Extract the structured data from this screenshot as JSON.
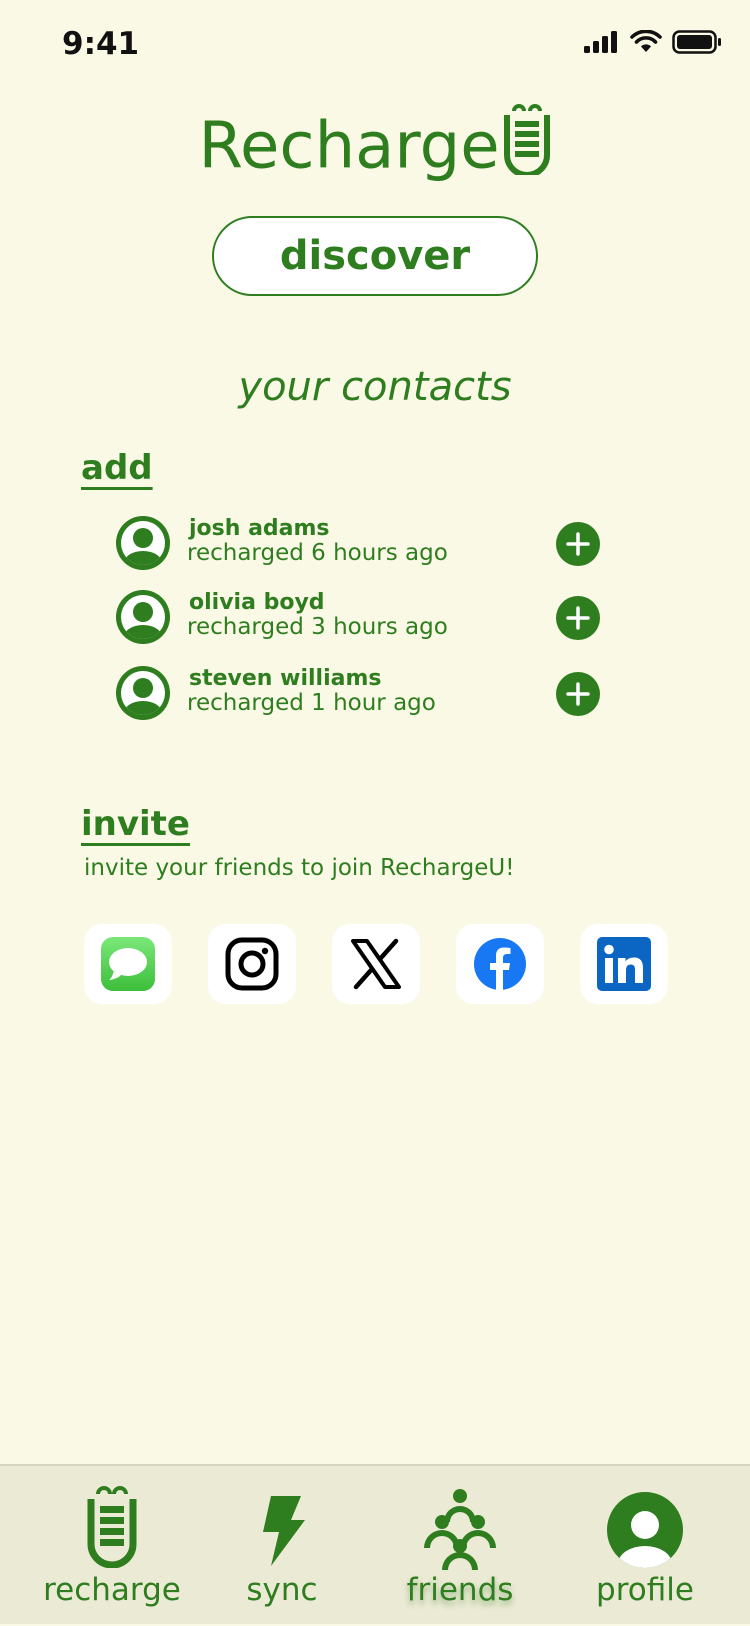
{
  "status_bar": {
    "time": "9:41"
  },
  "app": {
    "title": "Recharge"
  },
  "discover_label": "discover",
  "section_title": "your contacts",
  "add_section": {
    "heading": "add",
    "contacts": [
      {
        "name": "josh adams",
        "status": "recharged 6 hours ago"
      },
      {
        "name": "olivia boyd",
        "status": "recharged 3 hours ago"
      },
      {
        "name": "steven williams",
        "status": "recharged 1 hour ago"
      }
    ]
  },
  "invite_section": {
    "heading": "invite",
    "subtitle": "invite your friends to join RechargeU!",
    "share_icons": [
      "messages-icon",
      "instagram-icon",
      "x-icon",
      "facebook-icon",
      "linkedin-icon"
    ]
  },
  "tab_bar": {
    "active": "friends",
    "tabs": [
      {
        "label": "recharge",
        "icon": "battery-icon"
      },
      {
        "label": "sync",
        "icon": "lightning-icon"
      },
      {
        "label": "friends",
        "icon": "people-icon"
      },
      {
        "label": "profile",
        "icon": "profile-icon"
      }
    ]
  },
  "colors": {
    "primary": "#2E7D1F",
    "background": "#FAF9E6",
    "tab_bar_bg": "#EBEAD4",
    "facebook": "#1877F2",
    "linkedin": "#0A66C2",
    "messages": "#4CD964"
  }
}
